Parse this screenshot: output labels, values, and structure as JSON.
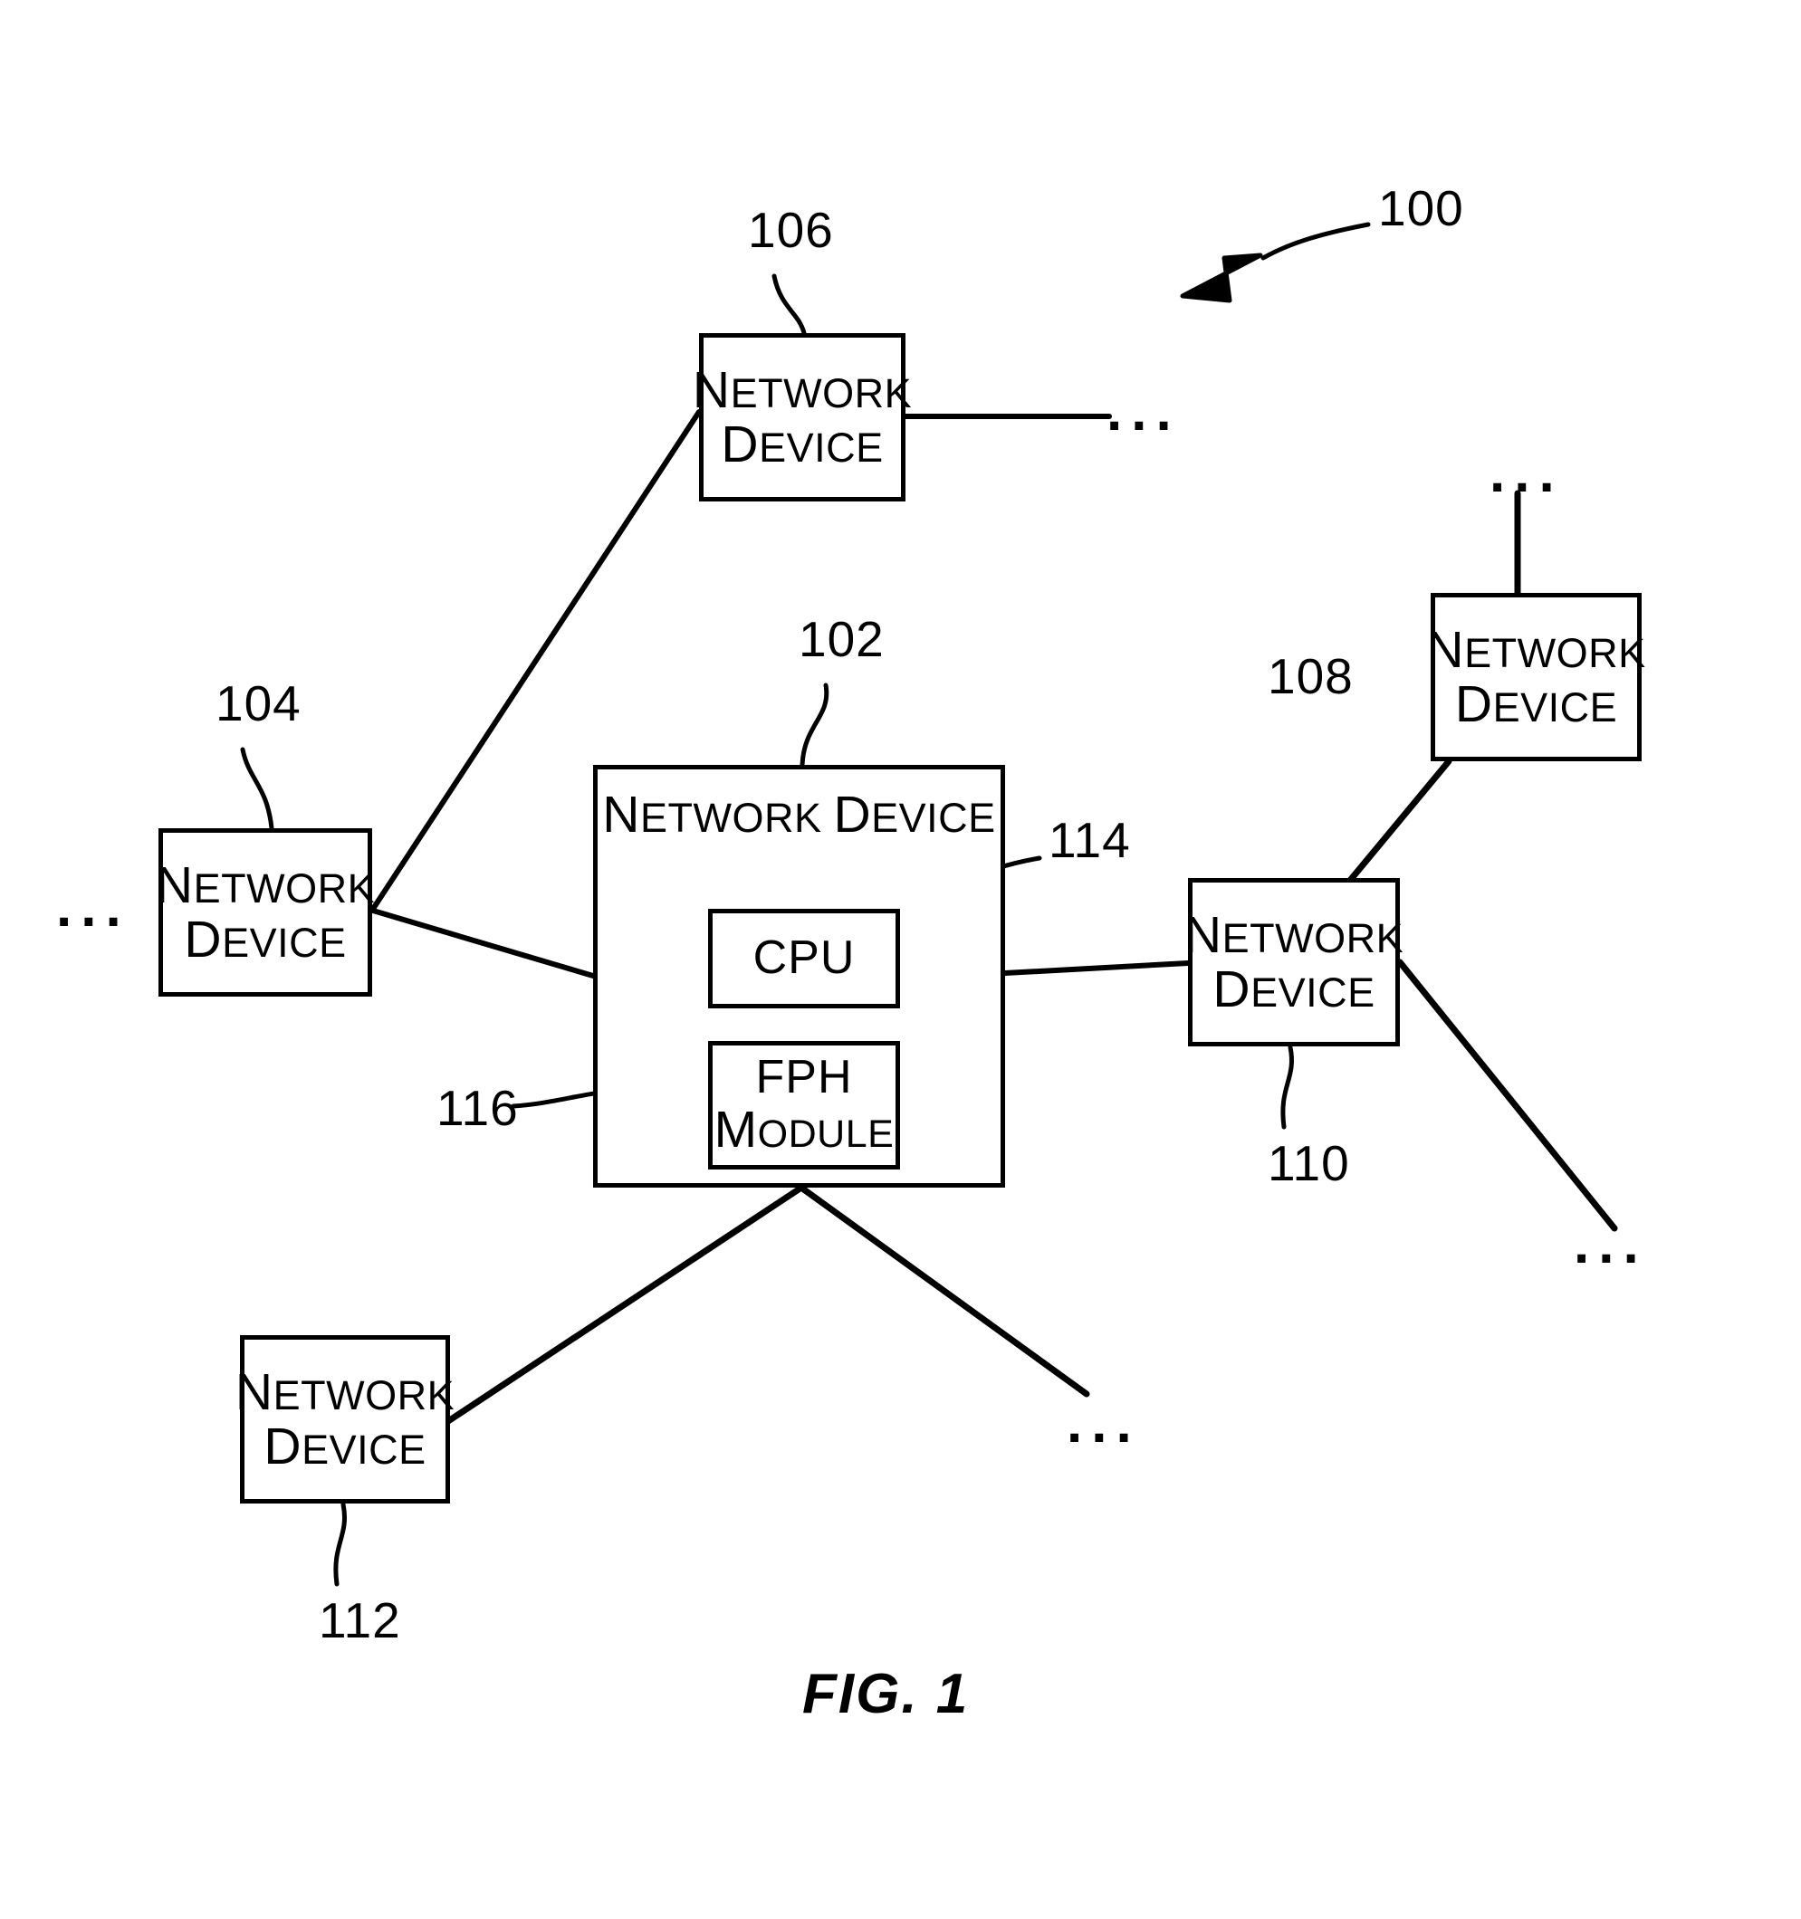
{
  "figure": {
    "caption": "FIG. 1",
    "system_ref": "100"
  },
  "nodes": [
    {
      "id": "main",
      "ref": "102",
      "title": "Network Device",
      "role": "central-network-device",
      "children": [
        {
          "id": "cpu",
          "ref": "114",
          "label": "CPU"
        },
        {
          "id": "fph",
          "ref": "116",
          "label_line1": "FPH",
          "label_line2": "Module"
        }
      ]
    },
    {
      "id": "nd104",
      "ref": "104",
      "line1": "Network",
      "line2": "Device"
    },
    {
      "id": "nd106",
      "ref": "106",
      "line1": "Network",
      "line2": "Device"
    },
    {
      "id": "nd108",
      "ref": "108",
      "line1": "Network",
      "line2": "Device"
    },
    {
      "id": "nd110",
      "ref": "110",
      "line1": "Network",
      "line2": "Device"
    },
    {
      "id": "nd112",
      "ref": "112",
      "line1": "Network",
      "line2": "Device"
    }
  ],
  "ellipses": {
    "left_of_104": "...",
    "right_of_106": "...",
    "above_108": "...",
    "below_right_of_110": "...",
    "below_right_of_main": "..."
  },
  "colors": {
    "stroke": "#000000",
    "background": "#ffffff"
  }
}
